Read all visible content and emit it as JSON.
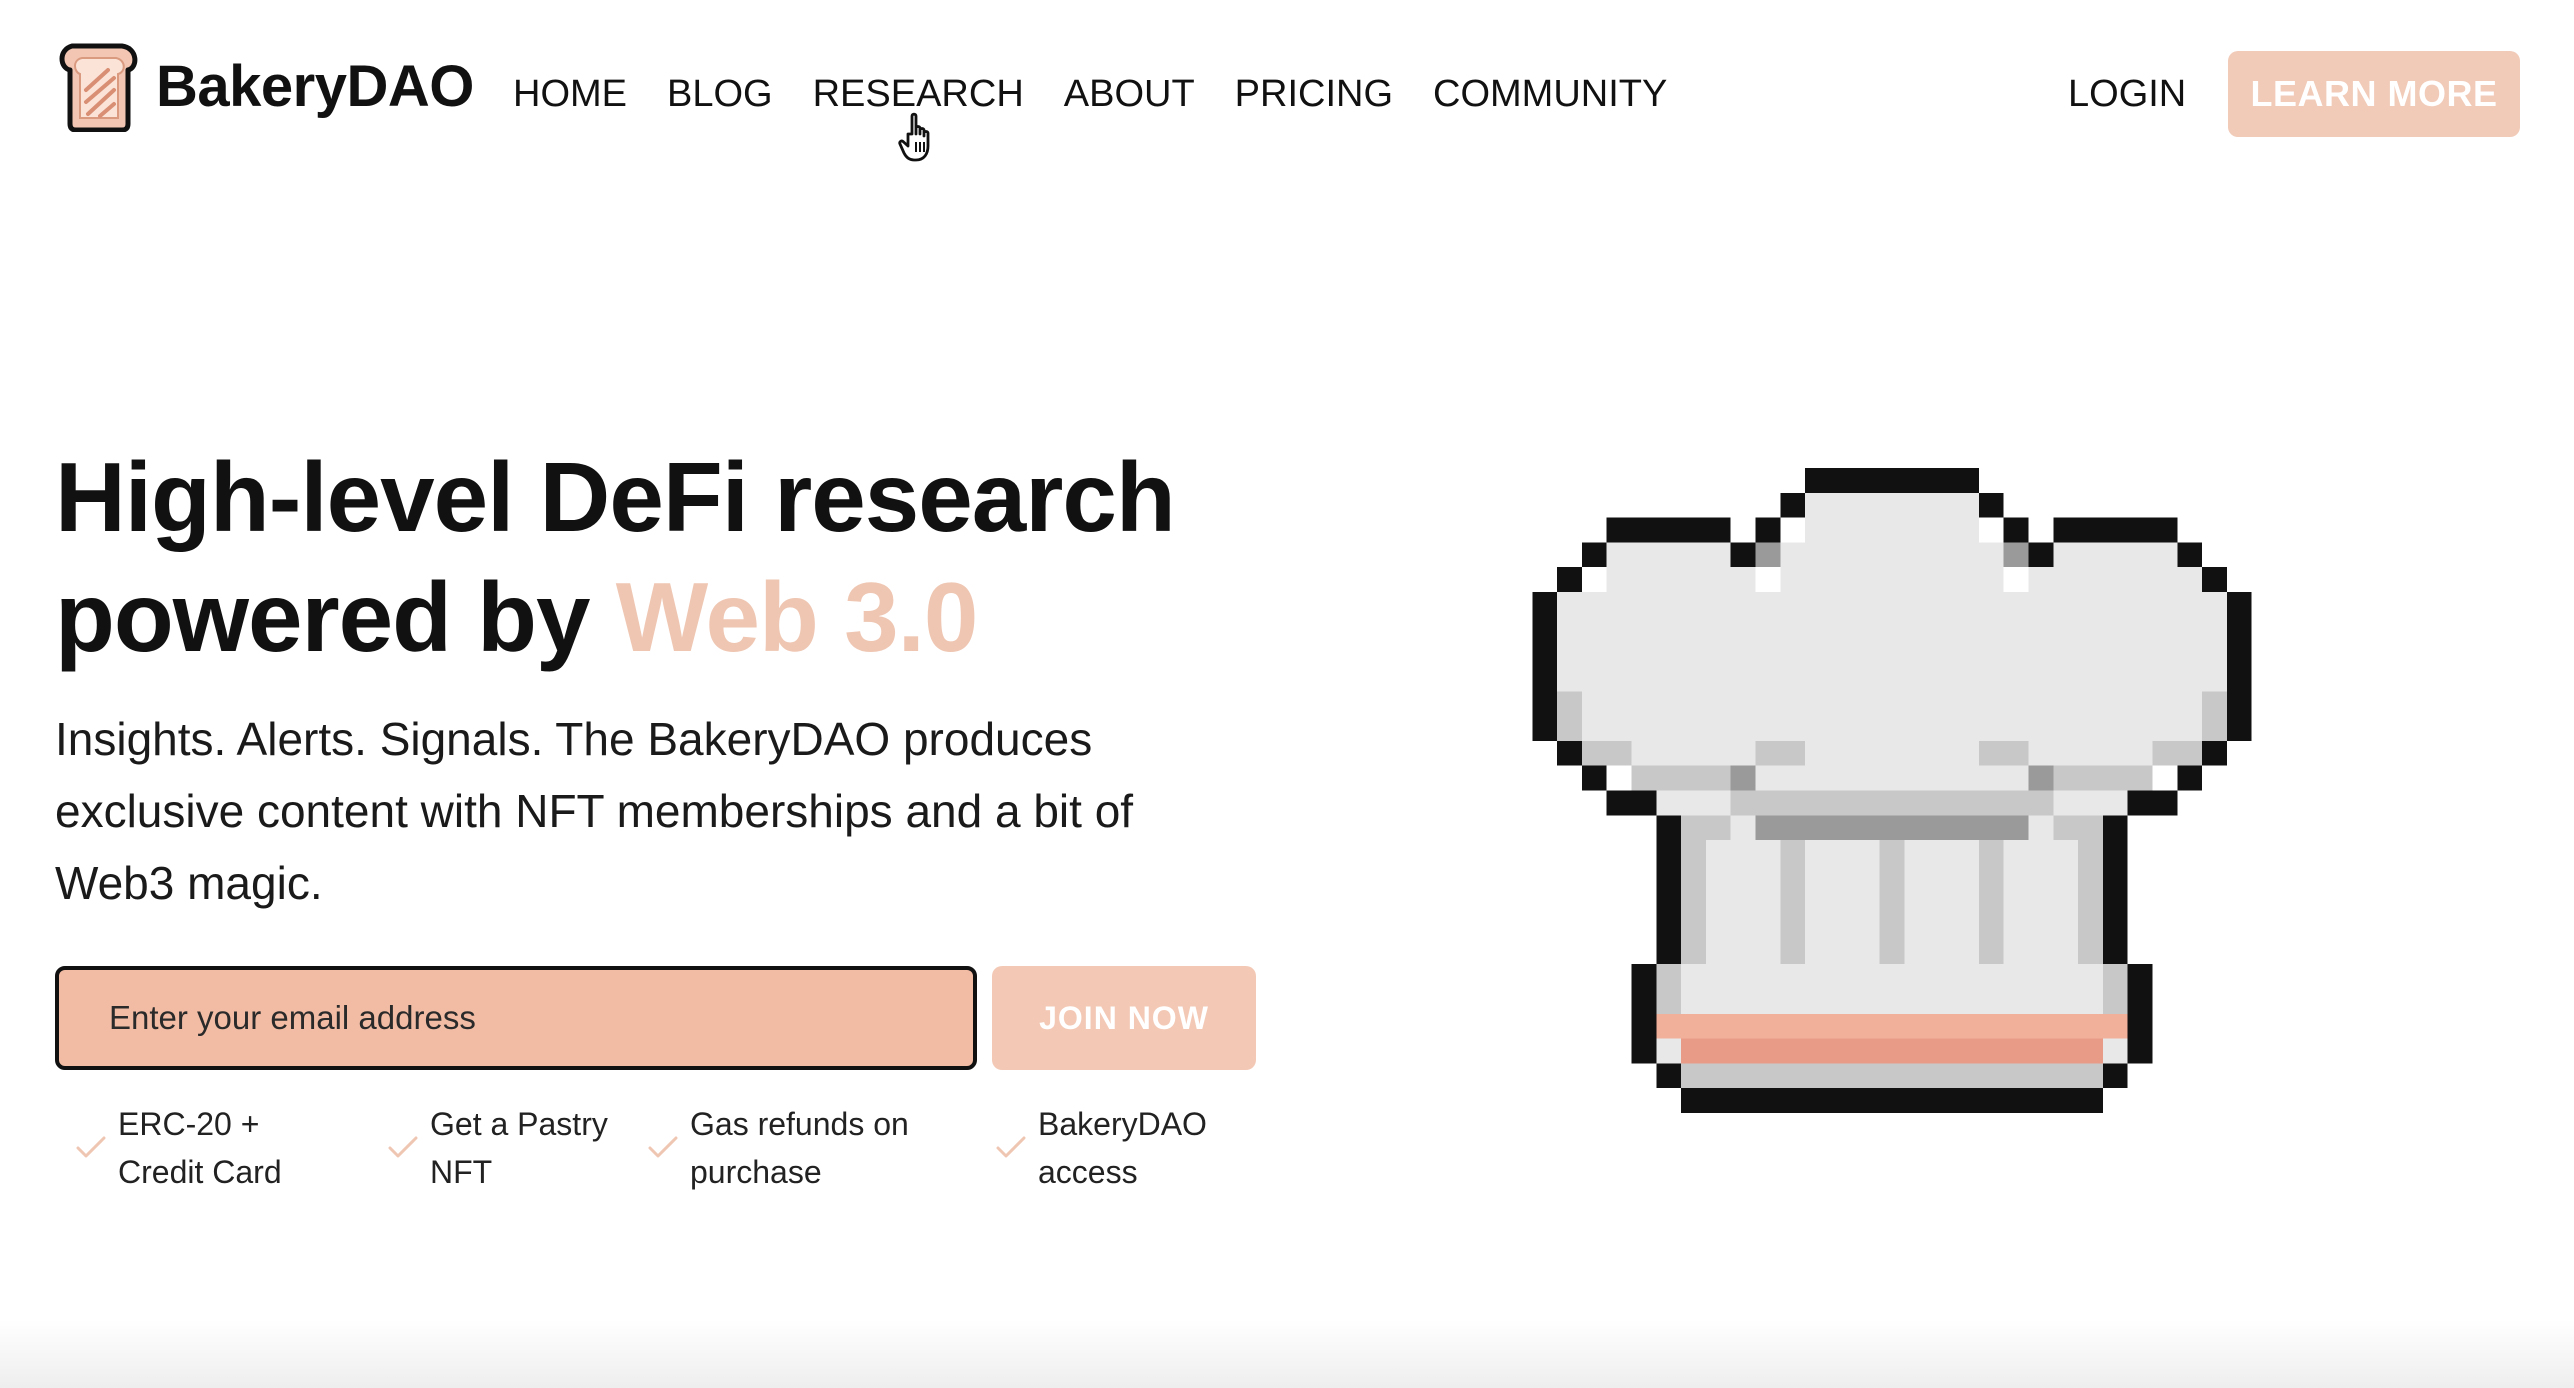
{
  "brand": {
    "name": "BakeryDAO",
    "accent_color": "#f1cab8",
    "icon": "toast-logo-icon"
  },
  "nav": {
    "links": [
      "HOME",
      "BLOG",
      "RESEARCH",
      "ABOUT",
      "PRICING",
      "COMMUNITY"
    ],
    "login_label": "LOGIN",
    "cta_label": "LEARN MORE"
  },
  "hero": {
    "headline_main": "High-level DeFi research powered by ",
    "headline_accent": "Web 3.0",
    "subtext": "Insights. Alerts. Signals. The BakeryDAO produces exclusive content with NFT memberships and a bit of Web3 magic.",
    "email_placeholder": "Enter your email address",
    "join_label": "JOIN NOW",
    "features": [
      "ERC-20 +\nCredit Card",
      "Get a Pastry\nNFT",
      "Gas refunds on\npurchase",
      "BakeryDAO\naccess"
    ],
    "illustration": "chef-hat-pixel-icon"
  }
}
